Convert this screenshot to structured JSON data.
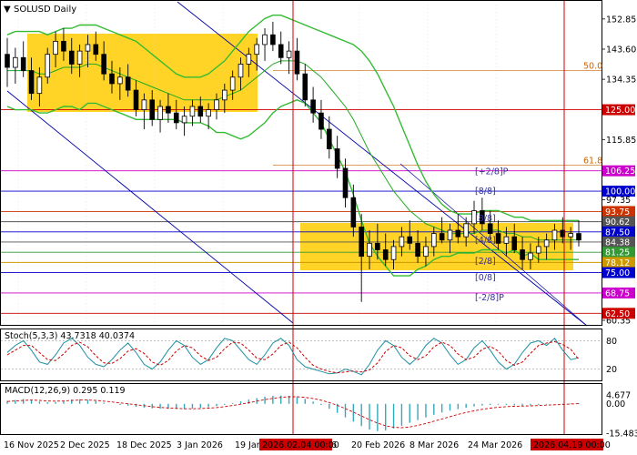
{
  "chart_data": {
    "type": "candlestick",
    "title": "SOLUSD Daily",
    "stoch_label": "Stoch(5,3,3) 43.7318 40.0374",
    "macd_label": "MACD(12,26,9) 0.295 0.119",
    "x_ticks": [
      "16 Nov 2025",
      "2 Dec 2025",
      "18 Dec 2025",
      "3 Jan 2026",
      "19 Jan",
      "6",
      "20 Feb 2026",
      "8 Mar 2026",
      "24 Mar 2026"
    ],
    "x_markers": [
      "2026.02.04 00:00",
      "2026.04.19 00:00"
    ],
    "y_ticks": [
      "152.85",
      "143.60",
      "134.35",
      "115.85",
      "97.35",
      "78.10",
      "60.35"
    ],
    "ylim": [
      60.35,
      157
    ],
    "stoch_ticks": [
      "80",
      "20"
    ],
    "macd_ticks": [
      "4.677",
      "0.00",
      "-15.483"
    ],
    "levels": [
      {
        "label": "125.00",
        "value": 125.0,
        "color": "#cc0000"
      },
      {
        "label": "106.25",
        "value": 106.25,
        "color": "#cc00cc"
      },
      {
        "label": "100.00",
        "value": 100.0,
        "color": "#0000cc"
      },
      {
        "label": "93.75",
        "value": 93.75,
        "color": "#cc3300"
      },
      {
        "label": "90.62",
        "value": 90.62,
        "color": "#555555"
      },
      {
        "label": "87.50",
        "value": 87.5,
        "color": "#0000cc"
      },
      {
        "label": "84.38",
        "value": 84.38,
        "color": "#555555"
      },
      {
        "label": "81.25",
        "value": 81.25,
        "color": "#339933"
      },
      {
        "label": "78.12",
        "value": 78.12,
        "color": "#cc9900"
      },
      {
        "label": "75.00",
        "value": 75.0,
        "color": "#0000cc"
      },
      {
        "label": "68.75",
        "value": 68.75,
        "color": "#cc00cc"
      },
      {
        "label": "62.50",
        "value": 62.5,
        "color": "#cc0000"
      }
    ],
    "fib_labels": [
      {
        "label": "50.0",
        "value": 137.0
      },
      {
        "label": "61.8",
        "value": 108.0
      }
    ],
    "murrey_labels": [
      {
        "label": "[+2/8]P",
        "value": 106.0
      },
      {
        "label": "[8/8]",
        "value": 100.0
      },
      {
        "label": "[8/8]",
        "value": 91.6
      },
      {
        "label": "[4/8]",
        "value": 85.0
      },
      {
        "label": "[2/8]",
        "value": 78.5
      },
      {
        "label": "[0/8]",
        "value": 73.5
      },
      {
        "label": "[-2/8]P",
        "value": 67.3
      }
    ],
    "candles": [
      [
        142,
        147,
        132,
        138
      ],
      [
        138,
        144,
        133,
        141
      ],
      [
        141,
        146,
        135,
        137
      ],
      [
        137,
        141,
        128,
        130
      ],
      [
        130,
        138,
        126,
        135
      ],
      [
        135,
        144,
        133,
        142
      ],
      [
        142,
        149,
        138,
        146
      ],
      [
        146,
        150,
        140,
        143
      ],
      [
        143,
        147,
        136,
        139
      ],
      [
        139,
        145,
        135,
        143
      ],
      [
        143,
        148,
        138,
        145
      ],
      [
        145,
        149,
        140,
        142
      ],
      [
        142,
        146,
        134,
        136
      ],
      [
        136,
        140,
        130,
        133
      ],
      [
        133,
        138,
        128,
        135
      ],
      [
        135,
        139,
        129,
        131
      ],
      [
        131,
        134,
        123,
        125
      ],
      [
        125,
        130,
        119,
        128
      ],
      [
        128,
        131,
        120,
        122
      ],
      [
        122,
        128,
        118,
        126
      ],
      [
        126,
        130,
        121,
        124
      ],
      [
        124,
        128,
        119,
        121
      ],
      [
        121,
        126,
        117,
        123
      ],
      [
        123,
        128,
        120,
        126
      ],
      [
        126,
        129,
        121,
        123
      ],
      [
        123,
        127,
        119,
        125
      ],
      [
        125,
        130,
        122,
        128
      ],
      [
        128,
        133,
        124,
        131
      ],
      [
        131,
        137,
        128,
        135
      ],
      [
        135,
        141,
        131,
        139
      ],
      [
        139,
        144,
        135,
        142
      ],
      [
        142,
        147,
        137,
        145
      ],
      [
        145,
        150,
        140,
        148
      ],
      [
        148,
        152,
        143,
        145
      ],
      [
        145,
        149,
        139,
        141
      ],
      [
        141,
        146,
        136,
        143
      ],
      [
        143,
        147,
        134,
        136
      ],
      [
        136,
        139,
        126,
        128
      ],
      [
        128,
        132,
        121,
        124
      ],
      [
        124,
        128,
        116,
        119
      ],
      [
        119,
        123,
        110,
        113
      ],
      [
        113,
        117,
        104,
        107
      ],
      [
        107,
        110,
        95,
        98
      ],
      [
        98,
        102,
        86,
        89
      ],
      [
        89,
        93,
        66,
        80
      ],
      [
        80,
        88,
        76,
        84
      ],
      [
        84,
        90,
        79,
        82
      ],
      [
        82,
        87,
        77,
        79
      ],
      [
        79,
        85,
        76,
        83
      ],
      [
        83,
        89,
        80,
        86
      ],
      [
        86,
        91,
        82,
        84
      ],
      [
        84,
        88,
        78,
        80
      ],
      [
        80,
        86,
        77,
        83
      ],
      [
        83,
        89,
        80,
        87
      ],
      [
        87,
        92,
        84,
        85
      ],
      [
        85,
        90,
        81,
        88
      ],
      [
        88,
        93,
        84,
        86
      ],
      [
        86,
        92,
        83,
        90
      ],
      [
        90,
        97,
        87,
        94
      ],
      [
        94,
        98,
        88,
        90
      ],
      [
        90,
        94,
        85,
        87
      ],
      [
        87,
        91,
        82,
        84
      ],
      [
        84,
        89,
        80,
        86
      ],
      [
        86,
        90,
        81,
        82
      ],
      [
        82,
        86,
        76,
        79
      ],
      [
        79,
        84,
        76,
        81
      ],
      [
        81,
        86,
        78,
        83
      ],
      [
        83,
        87,
        79,
        85
      ],
      [
        85,
        90,
        82,
        88
      ],
      [
        88,
        92,
        84,
        86
      ],
      [
        86,
        89,
        82,
        87
      ],
      [
        87,
        91,
        83,
        85
      ]
    ],
    "middle_band": [
      137,
      137,
      137,
      137,
      136,
      136,
      137,
      138,
      138,
      138,
      139,
      139,
      138,
      137,
      136,
      135,
      134,
      133,
      132,
      131,
      130,
      129,
      128,
      128,
      128,
      128,
      128,
      129,
      130,
      131,
      133,
      135,
      137,
      139,
      140,
      140,
      140,
      139,
      137,
      135,
      132,
      129,
      126,
      122,
      117,
      112,
      108,
      104,
      100,
      97,
      94,
      92,
      90,
      89,
      88,
      87,
      87,
      87,
      87,
      88,
      88,
      88,
      87,
      87,
      86,
      86,
      85,
      85,
      85,
      85,
      85,
      85
    ],
    "upper_band": [
      148,
      149,
      149,
      149,
      149,
      148,
      149,
      150,
      150,
      151,
      151,
      151,
      150,
      149,
      148,
      147,
      146,
      144,
      142,
      140,
      138,
      136,
      135,
      135,
      135,
      136,
      138,
      140,
      143,
      146,
      149,
      151,
      153,
      154,
      154,
      153,
      152,
      151,
      150,
      149,
      148,
      147,
      146,
      145,
      143,
      140,
      136,
      131,
      126,
      120,
      114,
      108,
      103,
      99,
      96,
      94,
      93,
      93,
      93,
      94,
      94,
      94,
      93,
      92,
      92,
      91,
      91,
      91,
      91,
      91,
      91,
      91
    ],
    "lower_band": [
      126,
      125,
      125,
      125,
      124,
      124,
      125,
      126,
      126,
      125,
      127,
      127,
      126,
      125,
      124,
      123,
      122,
      122,
      122,
      122,
      122,
      122,
      121,
      121,
      121,
      120,
      118,
      118,
      117,
      116,
      117,
      119,
      121,
      124,
      126,
      127,
      128,
      127,
      124,
      121,
      116,
      111,
      106,
      99,
      91,
      84,
      80,
      77,
      74,
      74,
      74,
      76,
      77,
      79,
      80,
      80,
      81,
      81,
      81,
      82,
      82,
      82,
      81,
      82,
      80,
      81,
      79,
      79,
      79,
      79,
      79,
      79
    ],
    "stoch_k": [
      55,
      70,
      80,
      60,
      35,
      30,
      50,
      75,
      85,
      70,
      45,
      30,
      25,
      40,
      60,
      75,
      55,
      30,
      20,
      35,
      60,
      80,
      70,
      45,
      30,
      40,
      65,
      85,
      80,
      60,
      40,
      30,
      50,
      75,
      85,
      70,
      40,
      25,
      20,
      15,
      10,
      12,
      20,
      15,
      8,
      30,
      60,
      80,
      70,
      45,
      30,
      45,
      70,
      85,
      75,
      50,
      30,
      40,
      65,
      80,
      60,
      35,
      20,
      30,
      55,
      75,
      80,
      70,
      85,
      60,
      40,
      44
    ],
    "stoch_d": [
      50,
      60,
      70,
      70,
      55,
      40,
      38,
      52,
      70,
      77,
      67,
      48,
      33,
      32,
      42,
      58,
      63,
      53,
      35,
      28,
      38,
      58,
      70,
      65,
      48,
      38,
      45,
      63,
      77,
      75,
      60,
      43,
      40,
      52,
      70,
      77,
      65,
      45,
      28,
      20,
      15,
      12,
      14,
      16,
      14,
      18,
      33,
      57,
      70,
      65,
      48,
      40,
      48,
      67,
      77,
      70,
      52,
      40,
      45,
      62,
      68,
      58,
      38,
      28,
      35,
      53,
      70,
      75,
      78,
      72,
      62,
      40
    ],
    "macd_hist": [
      1.5,
      2.0,
      2.5,
      2.0,
      1.2,
      0.8,
      1.0,
      1.6,
      2.2,
      2.4,
      2.1,
      1.4,
      0.6,
      0.0,
      -0.6,
      -1.0,
      -1.6,
      -2.0,
      -2.4,
      -2.6,
      -2.7,
      -2.8,
      -2.8,
      -2.5,
      -2.2,
      -1.8,
      -1.2,
      -0.5,
      0.4,
      1.3,
      2.2,
      3.0,
      3.8,
      4.2,
      4.4,
      4.2,
      3.6,
      2.6,
      1.2,
      -0.6,
      -2.6,
      -4.8,
      -7.2,
      -9.4,
      -11.8,
      -13.6,
      -14.4,
      -14.0,
      -13.0,
      -11.6,
      -10.0,
      -8.6,
      -7.2,
      -5.8,
      -4.6,
      -3.6,
      -2.8,
      -2.1,
      -1.4,
      -0.9,
      -0.6,
      -0.5,
      -0.6,
      -0.8,
      -0.9,
      -0.7,
      -0.5,
      -0.3,
      0.0,
      0.2,
      0.3,
      0.295
    ],
    "macd_signal": [
      1.2,
      1.5,
      1.8,
      2.0,
      1.8,
      1.5,
      1.4,
      1.5,
      1.8,
      2.0,
      2.0,
      1.8,
      1.4,
      1.0,
      0.5,
      0.0,
      -0.5,
      -1.0,
      -1.5,
      -1.9,
      -2.2,
      -2.4,
      -2.6,
      -2.6,
      -2.5,
      -2.3,
      -2.0,
      -1.5,
      -0.9,
      -0.2,
      0.6,
      1.4,
      2.2,
      2.9,
      3.4,
      3.7,
      3.7,
      3.4,
      2.8,
      1.9,
      0.7,
      -0.8,
      -2.5,
      -4.4,
      -6.4,
      -8.4,
      -10.2,
      -11.6,
      -12.4,
      -12.6,
      -12.2,
      -11.4,
      -10.4,
      -9.2,
      -8.0,
      -6.8,
      -5.6,
      -4.6,
      -3.7,
      -2.9,
      -2.3,
      -1.8,
      -1.5,
      -1.3,
      -1.2,
      -1.1,
      -0.9,
      -0.7,
      -0.5,
      -0.3,
      -0.1,
      0.119
    ]
  }
}
